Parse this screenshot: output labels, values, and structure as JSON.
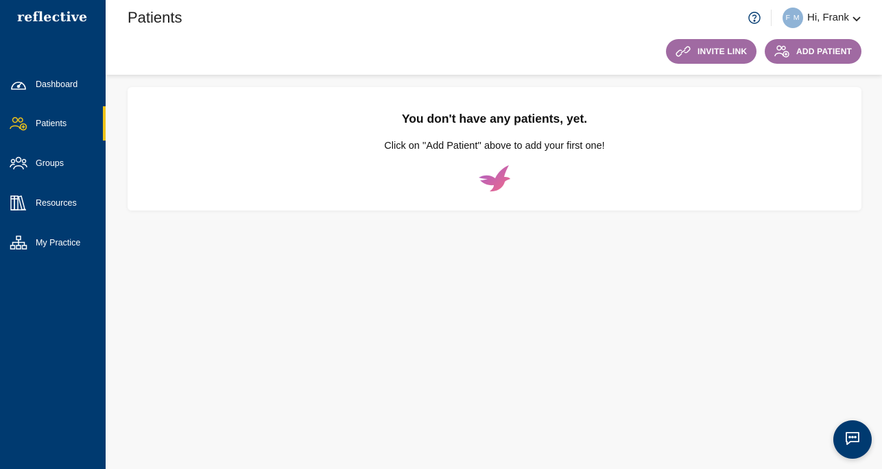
{
  "brand": {
    "logo_text": "reflective"
  },
  "sidebar": {
    "items": [
      {
        "label": "Dashboard",
        "icon": "dashboard-gauge-icon"
      },
      {
        "label": "Patients",
        "icon": "patients-icon",
        "active": true
      },
      {
        "label": "Groups",
        "icon": "groups-icon"
      },
      {
        "label": "Resources",
        "icon": "resources-books-icon"
      },
      {
        "label": "My Practice",
        "icon": "practice-org-icon"
      }
    ]
  },
  "header": {
    "title": "Patients",
    "help_icon": "help-circle-icon",
    "user_initials": "F M",
    "greeting": "Hi, Frank",
    "invite_label": "INVITE LINK",
    "add_label": "ADD PATIENT"
  },
  "empty_state": {
    "title": "You don't have any patients, yet.",
    "subtitle": "Click on ''Add Patient'' above to add your first one!"
  },
  "colors": {
    "sidebar_bg": "#003a70",
    "active_indicator": "#f0c419",
    "button_bg": "#a06aa2",
    "avatar_bg": "#8fb3d6"
  }
}
